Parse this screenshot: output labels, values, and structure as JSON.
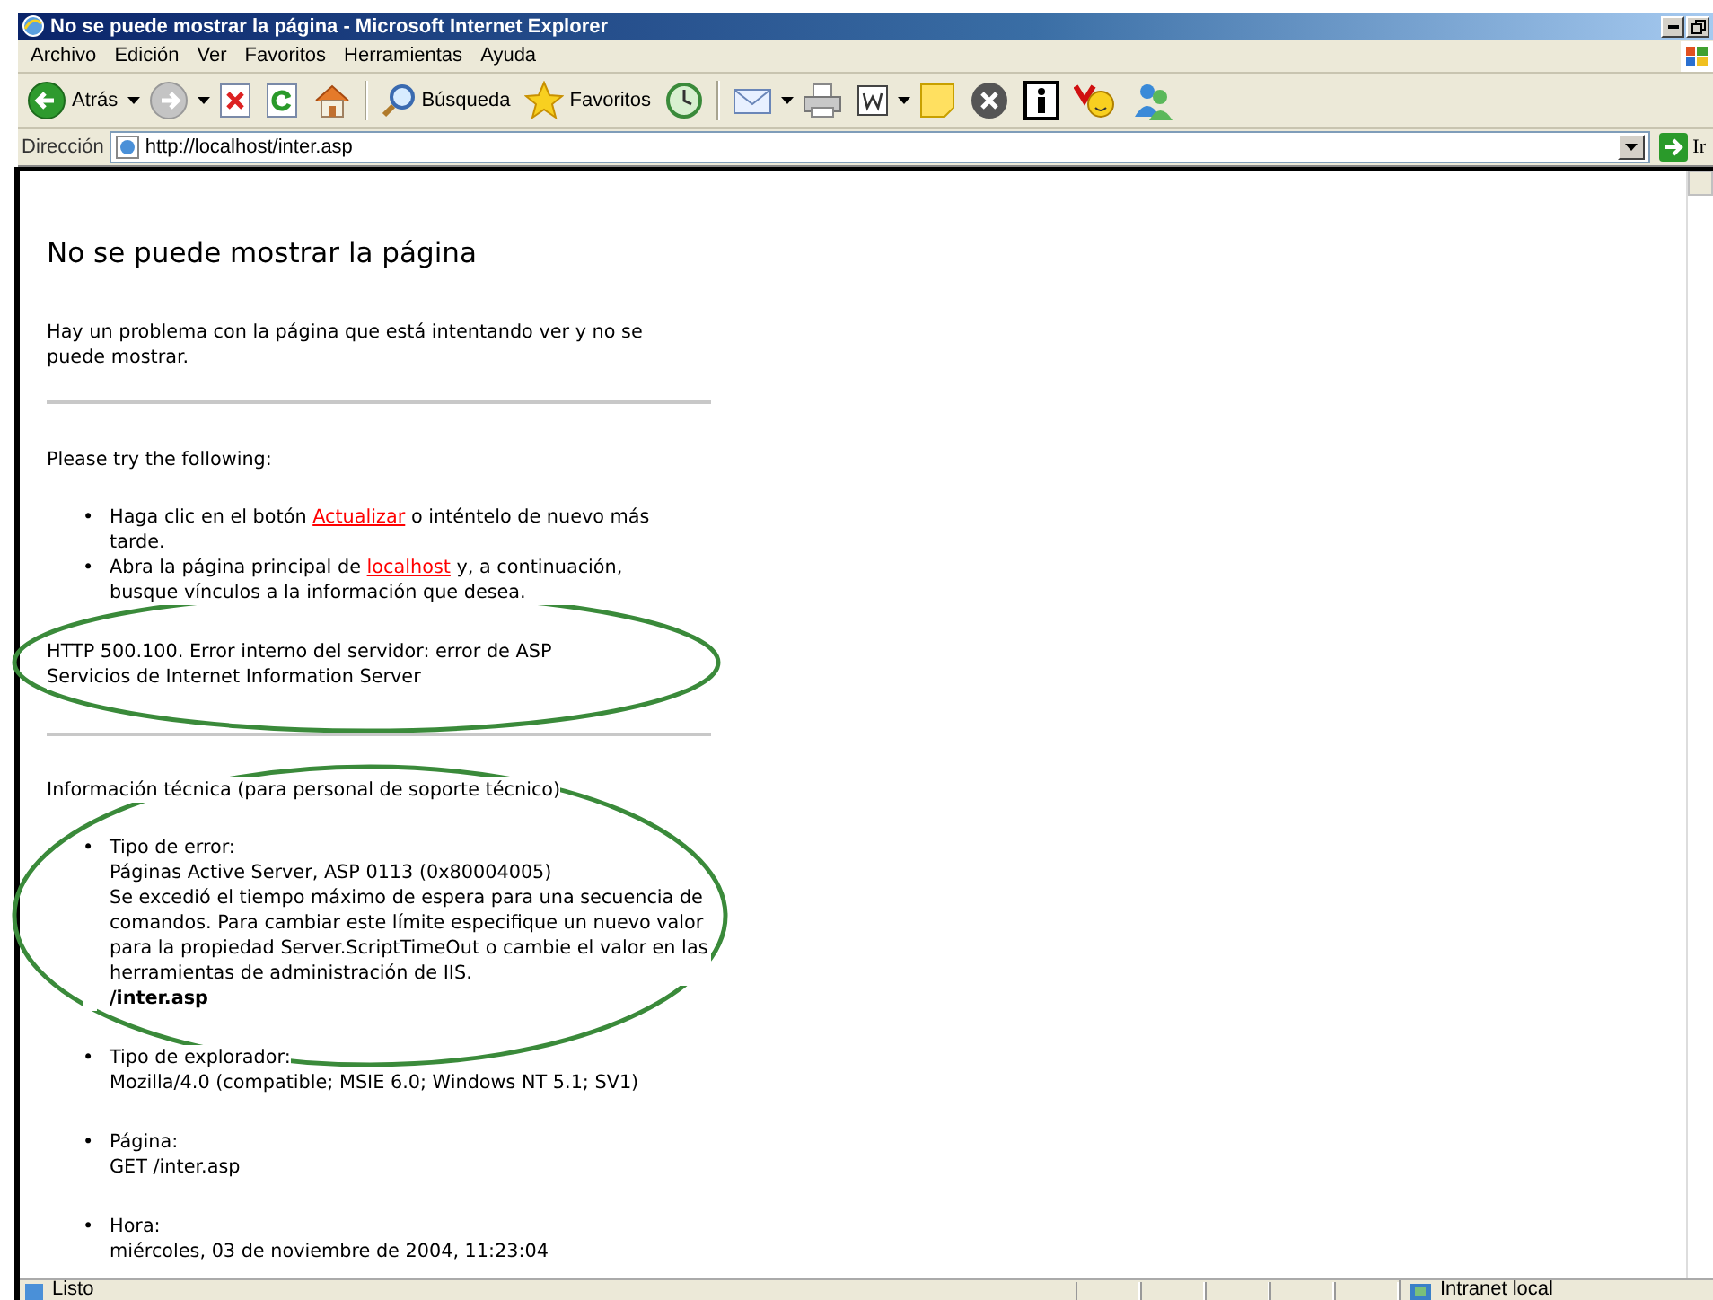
{
  "window": {
    "title": "No se puede mostrar la página - Microsoft Internet Explorer"
  },
  "menu": [
    "Archivo",
    "Edición",
    "Ver",
    "Favoritos",
    "Herramientas",
    "Ayuda"
  ],
  "toolbar": [
    {
      "kind": "back",
      "label": "Atrás"
    },
    {
      "kind": "forward"
    },
    {
      "kind": "stop"
    },
    {
      "kind": "refresh"
    },
    {
      "kind": "home"
    },
    {
      "kind": "search",
      "label": "Búsqueda"
    },
    {
      "kind": "favorites",
      "label": "Favoritos"
    },
    {
      "kind": "history"
    },
    {
      "kind": "mail"
    },
    {
      "kind": "print"
    },
    {
      "kind": "word"
    },
    {
      "kind": "note"
    },
    {
      "kind": "xcircle"
    },
    {
      "kind": "info"
    },
    {
      "kind": "smiley"
    },
    {
      "kind": "people"
    }
  ],
  "address": {
    "label": "Dirección",
    "value": "http://localhost/inter.asp",
    "go": "Ir"
  },
  "page": {
    "heading": "No se puede mostrar la página",
    "intro": "Hay un problema con la página que está intentando ver y no se puede mostrar.",
    "try_heading": "Please try the following:",
    "suggestions": [
      {
        "marker": "•",
        "parts": [
          {
            "text": "Haga clic en el botón "
          },
          {
            "link": "Actualizar"
          },
          {
            "text": " o inténtelo de nuevo más tarde."
          }
        ]
      },
      {
        "marker": "•",
        "parts": [
          {
            "text": "Abra la página principal de "
          },
          {
            "link": "localhost"
          },
          {
            "text": " y, a continuación, busque vínculos a la información que desea."
          }
        ]
      }
    ],
    "error_line": "HTTP 500.100. Error interno del servidor: error de ASP",
    "server_line": "Servicios de Internet Information Server",
    "tech_heading": "Información técnica (para personal de soporte técnico)",
    "details": [
      {
        "marker": "•",
        "label": "Tipo de error:",
        "lines": [
          "Páginas Active Server, ASP 0113 (0x80004005)",
          "Se excedió el tiempo máximo de espera para una secuencia de comandos. Para cambiar este límite especifique un nuevo valor para la propiedad Server.ScriptTimeOut o cambie el valor en las herramientas de administración de IIS."
        ],
        "path": "/inter.asp"
      },
      {
        "marker": "•",
        "label": "Tipo de explorador:",
        "lines": [
          "Mozilla/4.0 (compatible; MSIE 6.0; Windows NT 5.1; SV1)"
        ]
      },
      {
        "marker": "•",
        "label": "Página:",
        "lines": [
          "GET /inter.asp"
        ]
      },
      {
        "marker": "•",
        "label": "Hora:",
        "lines": [
          "miércoles, 03 de noviembre de 2004, 11:23:04"
        ]
      }
    ],
    "annotations": [
      {
        "kind": "ellipse"
      },
      {
        "kind": "ellipse"
      }
    ]
  },
  "status_bar": {
    "text": "Listo",
    "zone": "Intranet local"
  }
}
